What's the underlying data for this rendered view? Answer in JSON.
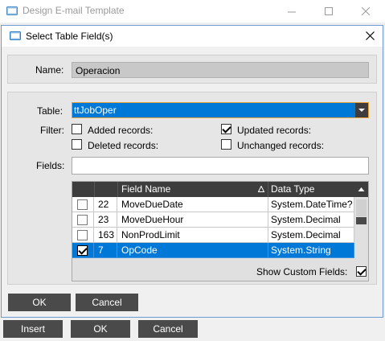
{
  "outer_window": {
    "title": "Design E-mail Template",
    "buttons": {
      "insert": "Insert",
      "ok": "OK",
      "cancel": "Cancel"
    }
  },
  "dialog": {
    "title": "Select Table Field(s)",
    "name_label": "Name:",
    "name_value": "Operacion",
    "table_label": "Table:",
    "table_value": "ttJobOper",
    "filter_label": "Filter:",
    "filters": [
      {
        "label": "Added records:",
        "checked": false
      },
      {
        "label": "Updated records:",
        "checked": true
      },
      {
        "label": "Deleted records:",
        "checked": false
      },
      {
        "label": "Unchanged records:",
        "checked": false
      }
    ],
    "fields_label": "Fields:",
    "fields_value": "",
    "grid": {
      "columns": [
        "Field Name",
        "Data Type"
      ],
      "rows": [
        {
          "checked": false,
          "num": "22",
          "name": "MoveDueDate",
          "type": "System.DateTime?",
          "selected": false
        },
        {
          "checked": false,
          "num": "23",
          "name": "MoveDueHour",
          "type": "System.Decimal",
          "selected": false
        },
        {
          "checked": false,
          "num": "163",
          "name": "NonProdLimit",
          "type": "System.Decimal",
          "selected": false
        },
        {
          "checked": true,
          "num": "7",
          "name": "OpCode",
          "type": "System.String",
          "selected": true
        }
      ]
    },
    "show_custom_label": "Show Custom Fields:",
    "show_custom_checked": true,
    "ok_label": "OK",
    "cancel_label": "Cancel"
  },
  "colors": {
    "selection": "#0078d7",
    "button_dark": "#4a4a4a",
    "grid_header": "#3d3d3d",
    "dropdown_border": "#e8a33a"
  }
}
